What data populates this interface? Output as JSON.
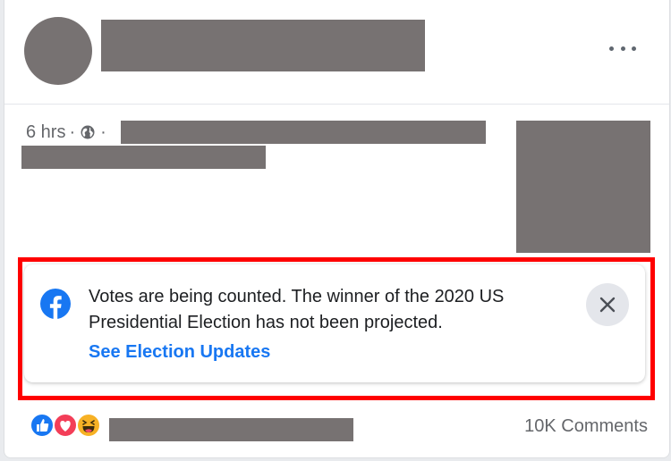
{
  "post": {
    "timestamp": "6 hrs",
    "separator": "·",
    "audience_icon": "globe-icon",
    "more_icon": "more-options-icon"
  },
  "notice": {
    "brand_icon": "facebook-icon",
    "message": "Votes are being counted. The winner of the 2020 US Presidential Election has not been projected.",
    "link_label": "See Election Updates",
    "close_icon": "close-icon"
  },
  "footer": {
    "reactions": [
      "like-reaction-icon",
      "love-reaction-icon",
      "haha-reaction-icon"
    ],
    "comments_label": "10K Comments"
  },
  "colors": {
    "accent": "#1877f2",
    "highlight_border": "#ff0000",
    "redaction": "#777272",
    "secondary_text": "#65676b"
  }
}
